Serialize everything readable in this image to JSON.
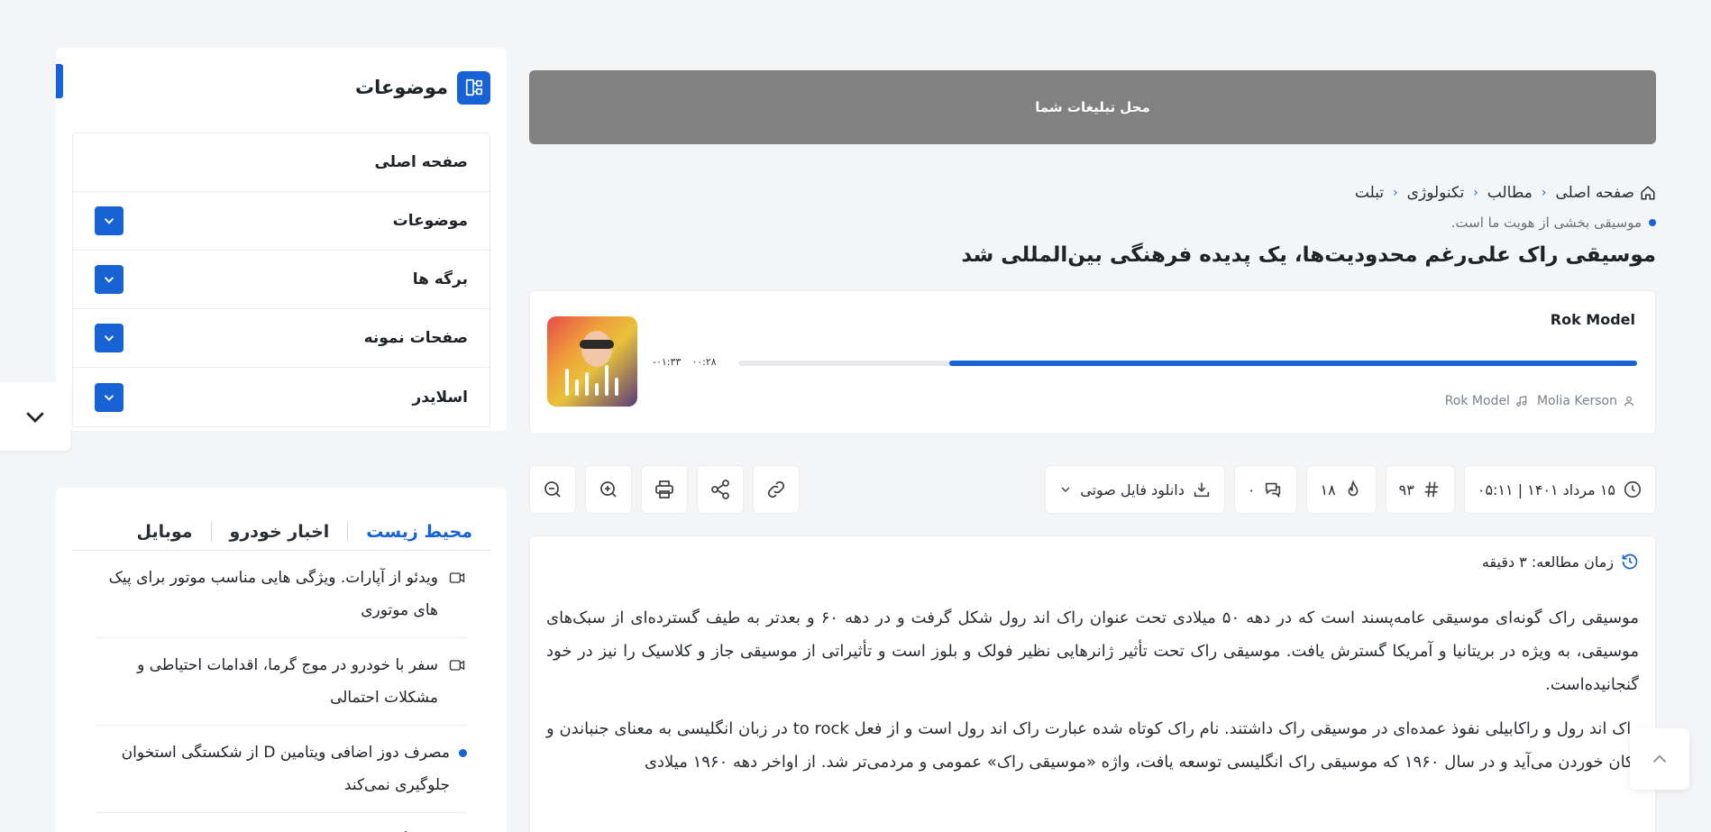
{
  "ad": {
    "label": "محل تبلیغات شما"
  },
  "breadcrumb": {
    "items": [
      "صفحه اصلی",
      "مطالب",
      "تکنولوژی",
      "تبلت"
    ]
  },
  "article": {
    "lead": "موسیقی بخشی از هویت ما است.",
    "title": "موسیقی راک علی‌رغم محدودیت‌ها، یک پدیده فرهنگی بین‌المللی شد",
    "read_time": "زمان مطالعه: ۳ دقیقه",
    "paragraphs": [
      "موسیقی راک گونه‌ای موسیقی عامه‌پسند است که در دهه ۵۰ میلادی تحت عنوان راک اند رول شکل گرفت و در دهه ۶۰ و بعدتر به طیف گسترده‌ای از سبک‌های موسیقی، به ویژه در بریتانیا و آمریکا گسترش یافت.  موسیقی راک تحت تأثیر ژانرهایی نظیر فولک و بلوز است  و تأثیراتی از موسیقی جاز و کلاسیک را نیز در خود گنجانیده‌است.",
      "راک اند رول و راکابیلی نفوذ عمده‌ای در موسیقی راک داشتند. نام راک کوتاه شده عبارت راک اند رول است و از فعل to rock در زبان انگلیسی به معنای جنباندن و تکان خوردن می‌آید و در سال ۱۹۶۰ که موسیقی راک انگلیسی توسعه یافت، واژه «موسیقی راک» عمومی و مردمی‌تر شد. از اواخر دهه ۱۹۶۰ میلادی"
    ]
  },
  "player": {
    "track": "Rok Model",
    "elapsed": "۰۰:۲۸",
    "remaining": "-۰۱:۳۳",
    "progress_fraction": 0.235,
    "artist": "Molia Kerson",
    "album": "Rok Model"
  },
  "toolbar": {
    "date": "۱۵ مرداد ۱۴۰۱ | ۰۵:۱۱",
    "post_id": "۹۳",
    "likes": "۱۸",
    "comments": "۰",
    "download_label": "دانلود فایل صوتی"
  },
  "sidebar": {
    "topics_title": "موضوعات",
    "menu": [
      {
        "label": "صفحه اصلی"
      },
      {
        "label": "موضوعات"
      },
      {
        "label": "برگه ها"
      },
      {
        "label": "صفحات نمونه"
      },
      {
        "label": "اسلایدر"
      }
    ],
    "tabs": [
      "محیط زیست",
      "اخبار خودرو",
      "موبایل"
    ],
    "news": [
      {
        "text": "ویدئو از آپارات. ویژگی هایی مناسب موتور برای پیک های موتوری",
        "type": "video"
      },
      {
        "text": "سفر با خودرو در موج گرما، اقدامات احتیاطی و مشکلات احتمالی",
        "type": "video"
      },
      {
        "text": "مصرف دوز اضافی ویتامین D از شکستگی استخوان جلوگیری نمی‌کند",
        "type": "dot"
      },
      {
        "text": "پژوهشگران چینی برنجی ساخته‌اند که با کود کمتر",
        "type": "dot"
      }
    ]
  },
  "colors": {
    "accent": "#1763d6",
    "ad_bg": "#818181",
    "page_bg": "#f4f5f7"
  }
}
